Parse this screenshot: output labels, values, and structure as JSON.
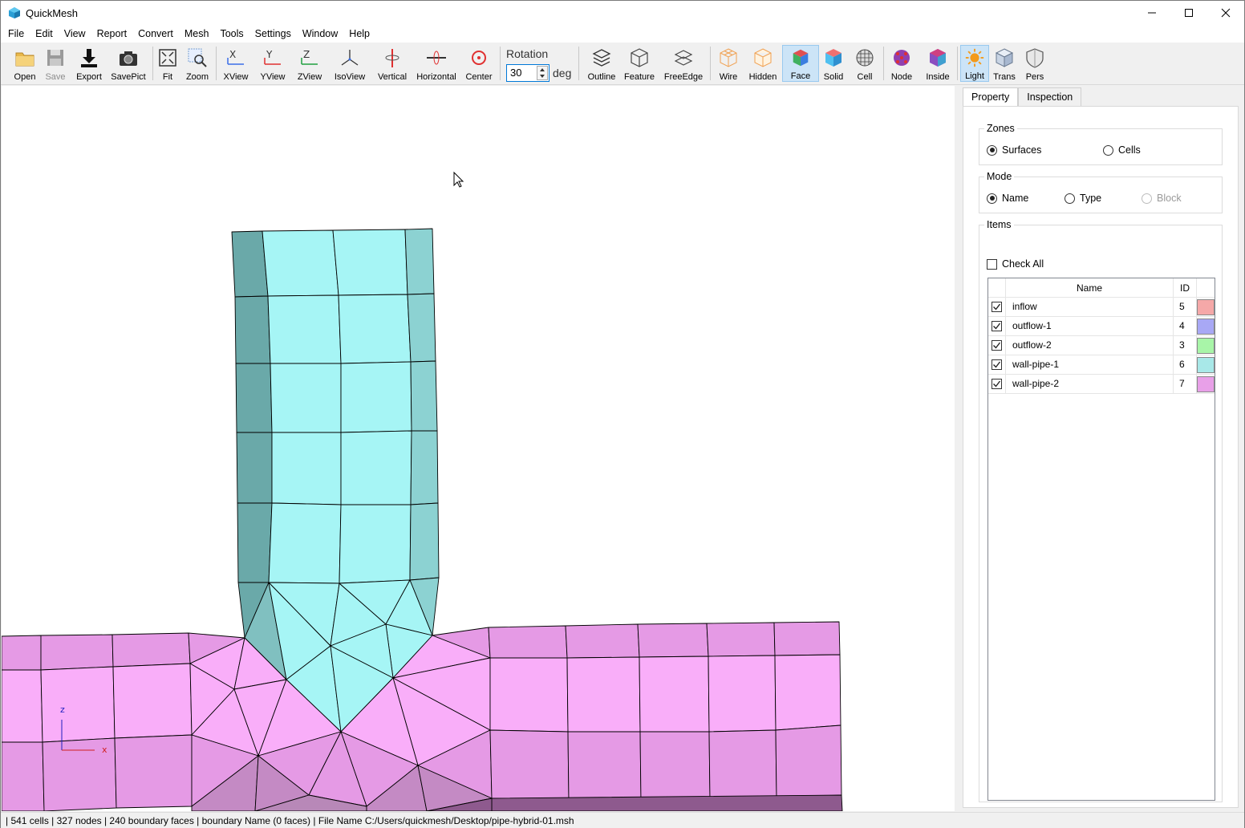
{
  "window": {
    "title": "QuickMesh",
    "icon": "quickmesh-app-icon",
    "controls": [
      "minimize-icon",
      "maximize-icon",
      "close-icon"
    ]
  },
  "menu": [
    "File",
    "Edit",
    "View",
    "Report",
    "Convert",
    "Mesh",
    "Tools",
    "Settings",
    "Window",
    "Help"
  ],
  "toolbar": {
    "open": "Open",
    "save": "Save",
    "export": "Export",
    "savepict": "SavePict",
    "fit": "Fit",
    "zoom": "Zoom",
    "xview": "XView",
    "yview": "YView",
    "zview": "ZView",
    "isoview": "IsoView",
    "vertical": "Vertical",
    "horizontal": "Horizontal",
    "center": "Center",
    "rotation_label": "Rotation",
    "rotation_value": "30",
    "rotation_unit": "deg",
    "outline": "Outline",
    "feature": "Feature",
    "freeedge": "FreeEdge",
    "wire": "Wire",
    "hidden": "Hidden",
    "face": "Face",
    "solid": "Solid",
    "cell": "Cell",
    "node": "Node",
    "inside": "Inside",
    "light": "Light",
    "trans": "Trans",
    "pers": "Pers",
    "active_modes": [
      "Face",
      "Light"
    ]
  },
  "viewport": {
    "axis_z": "z",
    "axis_x": "x",
    "colors": {
      "pipe_light": "#a6f5f5",
      "pipe_dark": "#6aa9a9",
      "wall2_light": "#f9aef9",
      "wall2_mid": "#e59ae5",
      "wall2_dark": "#b888b8",
      "wall2_darker": "#8e5a8e"
    }
  },
  "panel": {
    "tabs": [
      "Property",
      "Inspection"
    ],
    "active_tab": "Property",
    "zones": {
      "title": "Zones",
      "options": [
        "Surfaces",
        "Cells"
      ],
      "selected": "Surfaces"
    },
    "mode": {
      "title": "Mode",
      "options": [
        "Name",
        "Type",
        "Block"
      ],
      "selected": "Name",
      "disabled": [
        "Block"
      ]
    },
    "items": {
      "title": "Items",
      "check_all": "Check All",
      "columns": [
        "Name",
        "ID"
      ],
      "rows": [
        {
          "name": "inflow",
          "id": "5",
          "color": "#f5a8a8",
          "checked": true
        },
        {
          "name": "outflow-1",
          "id": "4",
          "color": "#a8a8f5",
          "checked": true
        },
        {
          "name": "outflow-2",
          "id": "3",
          "color": "#a8f5a8",
          "checked": true
        },
        {
          "name": "wall-pipe-1",
          "id": "6",
          "color": "#a8e8e8",
          "checked": true
        },
        {
          "name": "wall-pipe-2",
          "id": "7",
          "color": "#e8a0e8",
          "checked": true
        }
      ]
    }
  },
  "status": "| 541 cells | 327 nodes | 240 boundary faces |  boundary Name  (0 faces) | File Name C:/Users/quickmesh/Desktop/pipe-hybrid-01.msh"
}
